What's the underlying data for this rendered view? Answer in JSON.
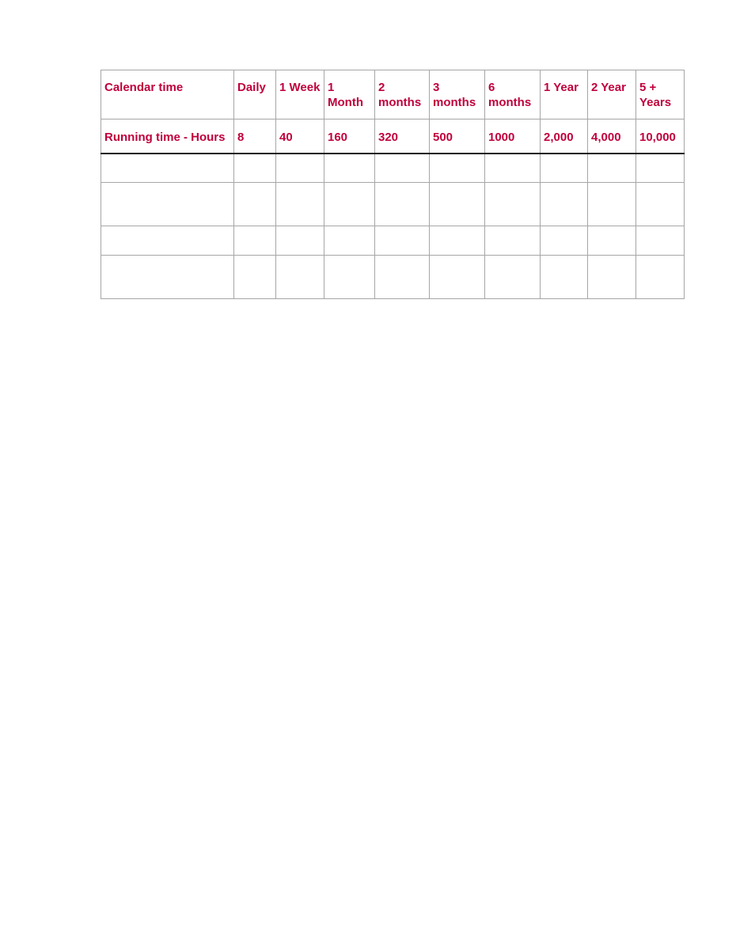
{
  "table": {
    "header_row": {
      "label": "Calendar time",
      "cells": [
        "Daily",
        "1 Week",
        "1 Month",
        "2 months",
        "3 months",
        "6 months",
        "1 Year",
        "2 Year",
        "5 + Years"
      ]
    },
    "hours_row": {
      "label": "Running time - Hours",
      "cells": [
        "8",
        "40",
        "160",
        "320",
        "500",
        "1000",
        "2,000",
        "4,000",
        "10,000"
      ]
    },
    "empty_rows": 4,
    "text_color": "#c0003c",
    "border_color": "#a6a6a6"
  }
}
